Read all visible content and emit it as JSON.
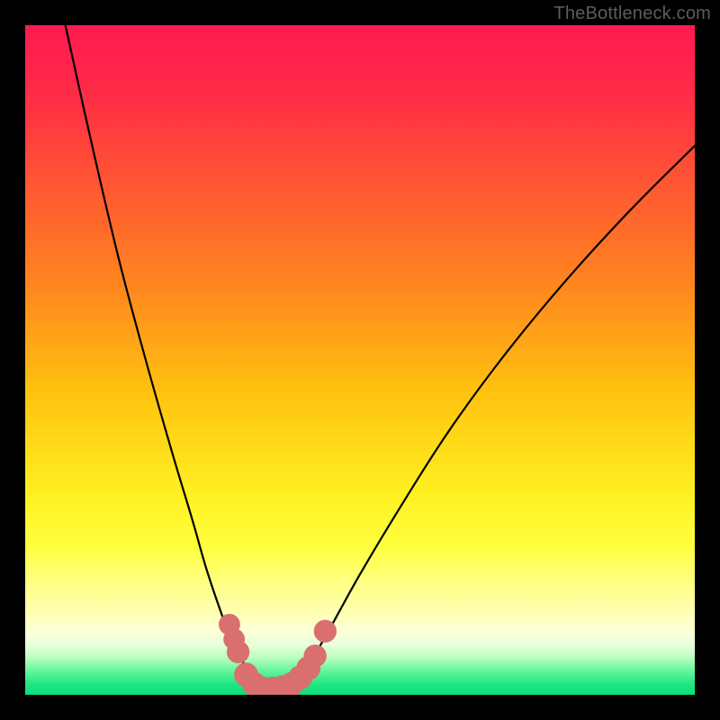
{
  "watermark": "TheBottleneck.com",
  "chart_data": {
    "type": "line",
    "title": "",
    "xlabel": "",
    "ylabel": "",
    "xlim": [
      0,
      100
    ],
    "ylim": [
      0,
      100
    ],
    "gradient_stops": [
      {
        "offset": 0.0,
        "color": "#ff1a52"
      },
      {
        "offset": 0.1,
        "color": "#ff2b47"
      },
      {
        "offset": 0.25,
        "color": "#ff5a30"
      },
      {
        "offset": 0.4,
        "color": "#ff8a1d"
      },
      {
        "offset": 0.55,
        "color": "#ffc310"
      },
      {
        "offset": 0.7,
        "color": "#fff020"
      },
      {
        "offset": 0.78,
        "color": "#ffff40"
      },
      {
        "offset": 0.83,
        "color": "#ffff80"
      },
      {
        "offset": 0.88,
        "color": "#ffffb5"
      },
      {
        "offset": 0.905,
        "color": "#fdffd8"
      },
      {
        "offset": 0.925,
        "color": "#e8ffda"
      },
      {
        "offset": 0.945,
        "color": "#b8ffbf"
      },
      {
        "offset": 0.965,
        "color": "#62f598"
      },
      {
        "offset": 0.985,
        "color": "#1ee682"
      },
      {
        "offset": 1.0,
        "color": "#09e07a"
      }
    ],
    "series": [
      {
        "name": "left-branch",
        "x": [
          6,
          10,
          14,
          18,
          22,
          25,
          27,
          29,
          30.5,
          32,
          33,
          34,
          35
        ],
        "values": [
          100,
          82,
          65,
          50,
          36,
          26,
          19,
          13,
          9,
          6,
          4,
          2.5,
          1.5
        ]
      },
      {
        "name": "right-branch",
        "x": [
          40,
          42,
          45,
          50,
          56,
          63,
          71,
          80,
          90,
          100
        ],
        "values": [
          1.5,
          4,
          9,
          18,
          28,
          39,
          50,
          61,
          72,
          82
        ]
      }
    ],
    "markers": {
      "name": "highlight-dots",
      "color": "#d9706f",
      "points": [
        {
          "x": 30.5,
          "y": 10.5,
          "r": 1.6
        },
        {
          "x": 31.2,
          "y": 8.3,
          "r": 1.6
        },
        {
          "x": 31.8,
          "y": 6.4,
          "r": 1.7
        },
        {
          "x": 33.0,
          "y": 3.0,
          "r": 1.8
        },
        {
          "x": 34.2,
          "y": 1.6,
          "r": 1.8
        },
        {
          "x": 35.6,
          "y": 0.9,
          "r": 1.8
        },
        {
          "x": 37.0,
          "y": 0.9,
          "r": 1.8
        },
        {
          "x": 38.4,
          "y": 1.1,
          "r": 1.8
        },
        {
          "x": 39.8,
          "y": 1.6,
          "r": 1.8
        },
        {
          "x": 41.1,
          "y": 2.6,
          "r": 1.8
        },
        {
          "x": 42.3,
          "y": 4.0,
          "r": 1.8
        },
        {
          "x": 43.3,
          "y": 5.8,
          "r": 1.7
        },
        {
          "x": 44.8,
          "y": 9.5,
          "r": 1.7
        }
      ]
    }
  }
}
